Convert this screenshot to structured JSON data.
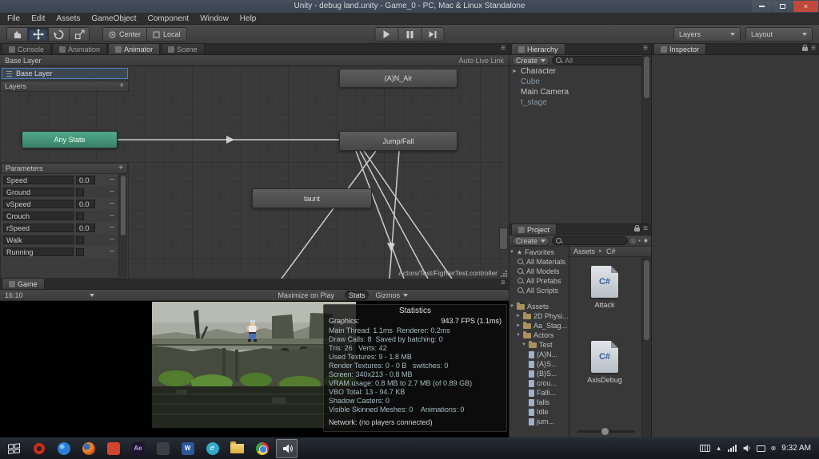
{
  "window": {
    "title": "Unity - debug land.unity - Game_0 - PC, Mac & Linux Standalone"
  },
  "menu": {
    "items": [
      "File",
      "Edit",
      "Assets",
      "GameObject",
      "Component",
      "Window",
      "Help"
    ]
  },
  "toolbar": {
    "center": "Center",
    "local": "Local",
    "layers": "Layers",
    "layout": "Layout"
  },
  "animator": {
    "tabs": {
      "console": "Console",
      "animation": "Animation",
      "animator": "Animator",
      "scene": "Scene"
    },
    "breadcrumb": "Base Layer",
    "auto_live_link": "Auto Live Link",
    "layer_item": "Base Layer",
    "layers_header": "Layers",
    "nodes": {
      "n_air": "(A)N_Air",
      "any_state": "Any State",
      "jump_fall": "Jump/Fall",
      "taunt": "taunt"
    },
    "parameters": {
      "header": "Parameters",
      "rows": [
        {
          "name": "Speed",
          "value": "0.0"
        },
        {
          "name": "Ground"
        },
        {
          "name": "vSpeed",
          "value": "0.0"
        },
        {
          "name": "Crouch"
        },
        {
          "name": "rSpeed",
          "value": "0.0"
        },
        {
          "name": "Walk"
        },
        {
          "name": "Running"
        }
      ]
    },
    "controller_path": "Actors/Test/FighterTest.controller"
  },
  "game": {
    "tab": "Game",
    "aspect": "16:10",
    "maximize_on_play": "Maximize on Play",
    "stats_button": "Stats",
    "gizmos": "Gizmos"
  },
  "statistics": {
    "title": "Statistics",
    "graphics_label": "Graphics:",
    "fps": "943.7 FPS (1.1ms)",
    "lines": [
      "Main Thread: 1.1ms  Renderer: 0.2ms",
      "Draw Calls: 8  Saved by batching: 0",
      "Tris: 26   Verts: 42",
      "Used Textures: 9 - 1.8 MB",
      "Render Textures: 0 - 0 B   switches: 0",
      "Screen: 340x213 - 0.8 MB",
      "VRAM usage: 0.8 MB to 2.7 MB (of 0.89 GB)",
      "VBO Total: 13 - 94.7 KB",
      "Shadow Casters: 0",
      "Visible Skinned Meshes: 0    Animations: 0"
    ],
    "network": "Network: (no players connected)"
  },
  "hierarchy": {
    "tab": "Hierarchy",
    "create": "Create",
    "search_filter": "All",
    "items": [
      {
        "label": "Character"
      },
      {
        "label": "Cube"
      },
      {
        "label": "Main Camera"
      },
      {
        "label": "t_stage"
      }
    ]
  },
  "inspector": {
    "tab": "Inspector"
  },
  "project": {
    "tab": "Project",
    "create": "Create",
    "favorites_header": "Favorites",
    "favorites": [
      "All Materials",
      "All Models",
      "All Prefabs",
      "All Scripts"
    ],
    "assets_header": "Assets",
    "folders": [
      "2D Physi...",
      "Aa_Stag...",
      "Actors",
      "Test"
    ],
    "test_children": [
      "(A)N...",
      "(A)S...",
      "(B)S...",
      "crou...",
      "Falli...",
      "falls",
      "Idle",
      "jum..."
    ],
    "breadcrumb": {
      "root": "Assets",
      "current": "C#"
    },
    "cs_label": "C#",
    "files": [
      {
        "name": "Attack"
      },
      {
        "name": "AxisDebug"
      }
    ]
  },
  "taskbar": {
    "time": "9:32 AM",
    "app_labels": {
      "ae": "Ae",
      "word": "W",
      "ie": "e"
    }
  }
}
